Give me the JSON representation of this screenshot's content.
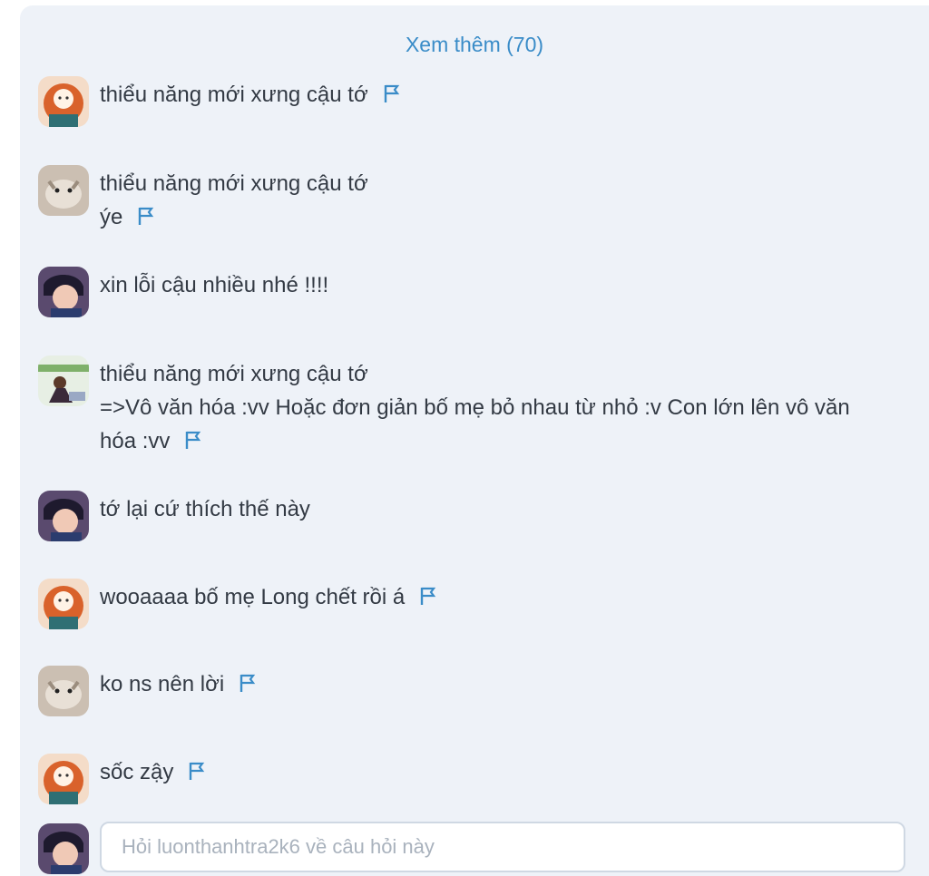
{
  "see_more": "Xem thêm (70)",
  "comments": [
    {
      "lines": [
        "thiểu năng mới xưng cậu tớ"
      ],
      "flag": true
    },
    {
      "lines": [
        "thiểu năng mới xưng cậu tớ",
        "ýe"
      ],
      "flag": true
    },
    {
      "lines": [
        "xin lỗi cậu nhiều nhé !!!!"
      ],
      "flag": false
    },
    {
      "lines": [
        "thiểu năng mới xưng cậu tớ",
        "=>Vô văn hóa :vv Hoặc đơn giản bố mẹ bỏ nhau từ nhỏ :v Con lớn lên vô văn",
        "hóa :vv"
      ],
      "flag": true
    },
    {
      "lines": [
        "tớ lại cứ thích thế này"
      ],
      "flag": false
    },
    {
      "lines": [
        "wooaaaa bố mẹ Long chết rồi á"
      ],
      "flag": true
    },
    {
      "lines": [
        "ko ns nên lời"
      ],
      "flag": true
    },
    {
      "lines": [
        "sốc zậy"
      ],
      "flag": true
    }
  ],
  "reply": {
    "placeholder": "Hỏi luonthanhtra2k6 về câu hỏi này"
  },
  "colors": {
    "link": "#3a8cc8",
    "flag": "#3a8cc8",
    "panel_bg": "#eef2f8"
  }
}
